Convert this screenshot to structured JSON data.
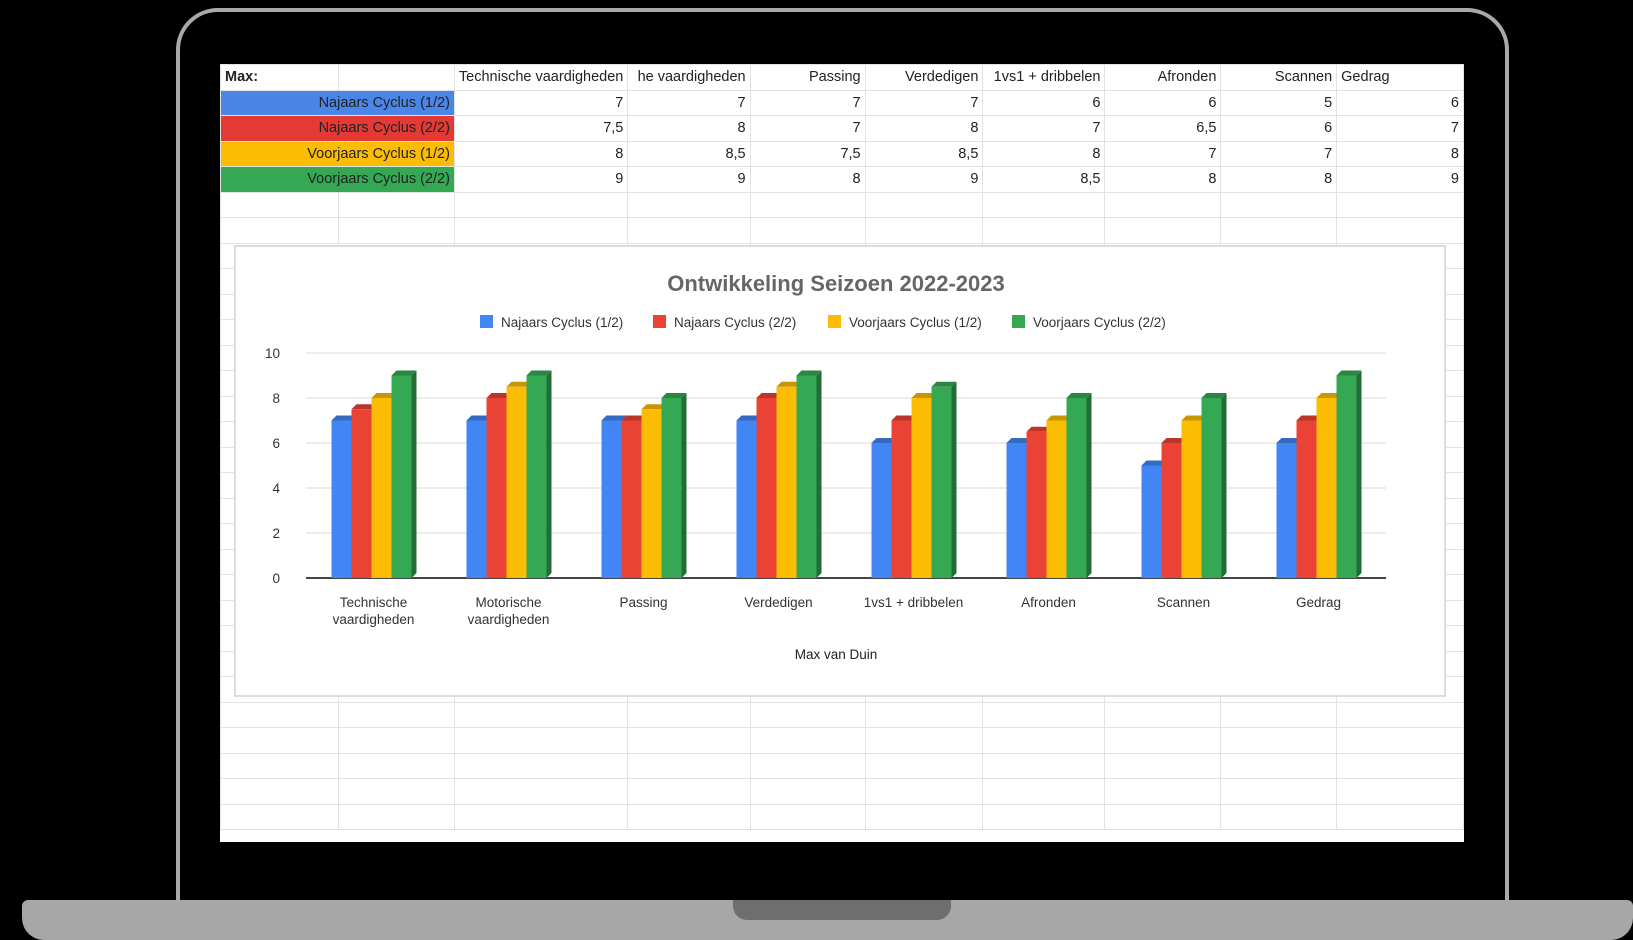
{
  "sheet": {
    "corner_label": "Max:",
    "column_headers": [
      "Technische vaardigheden",
      "he vaardigheden",
      "Passing",
      "Verdedigen",
      "1vs1 + dribbelen",
      "Afronden",
      "Scannen",
      "Gedrag"
    ],
    "rows": [
      {
        "label": "Najaars Cyclus (1/2)",
        "color": "#4a86e8",
        "values": [
          "7",
          "7",
          "7",
          "7",
          "6",
          "6",
          "5",
          "6"
        ]
      },
      {
        "label": "Najaars Cyclus (2/2)",
        "color": "#e53935",
        "values": [
          "7,5",
          "8",
          "7",
          "8",
          "7",
          "6,5",
          "6",
          "7"
        ]
      },
      {
        "label": "Voorjaars Cyclus (1/2)",
        "color": "#fbbc04",
        "values": [
          "8",
          "8,5",
          "7,5",
          "8,5",
          "8",
          "7",
          "7",
          "8"
        ]
      },
      {
        "label": "Voorjaars Cyclus (2/2)",
        "color": "#34a853",
        "values": [
          "9",
          "9",
          "8",
          "9",
          "8,5",
          "8",
          "8",
          "9"
        ]
      }
    ]
  },
  "chart_data": {
    "type": "bar",
    "title": "Ontwikkeling Seizoen 2022-2023",
    "xlabel": "Max van Duin",
    "ylabel": "",
    "ylim": [
      0,
      10
    ],
    "yticks": [
      0,
      2,
      4,
      6,
      8,
      10
    ],
    "grid": true,
    "legend_position": "top",
    "categories": [
      "Technische vaardigheden",
      "Motorische vaardigheden",
      "Passing",
      "Verdedigen",
      "1vs1 + dribbelen",
      "Afronden",
      "Scannen",
      "Gedrag"
    ],
    "series": [
      {
        "name": "Najaars Cyclus (1/2)",
        "color": "#4285f4",
        "values": [
          7,
          7,
          7,
          7,
          6,
          6,
          5,
          6
        ]
      },
      {
        "name": "Najaars Cyclus (2/2)",
        "color": "#ea4335",
        "values": [
          7.5,
          8,
          7,
          8,
          7,
          6.5,
          6,
          7
        ]
      },
      {
        "name": "Voorjaars Cyclus (1/2)",
        "color": "#fbbc04",
        "values": [
          8,
          8.5,
          7.5,
          8.5,
          8,
          7,
          7,
          8
        ]
      },
      {
        "name": "Voorjaars Cyclus (2/2)",
        "color": "#34a853",
        "values": [
          9,
          9,
          8,
          9,
          8.5,
          8,
          8,
          9
        ]
      }
    ]
  }
}
